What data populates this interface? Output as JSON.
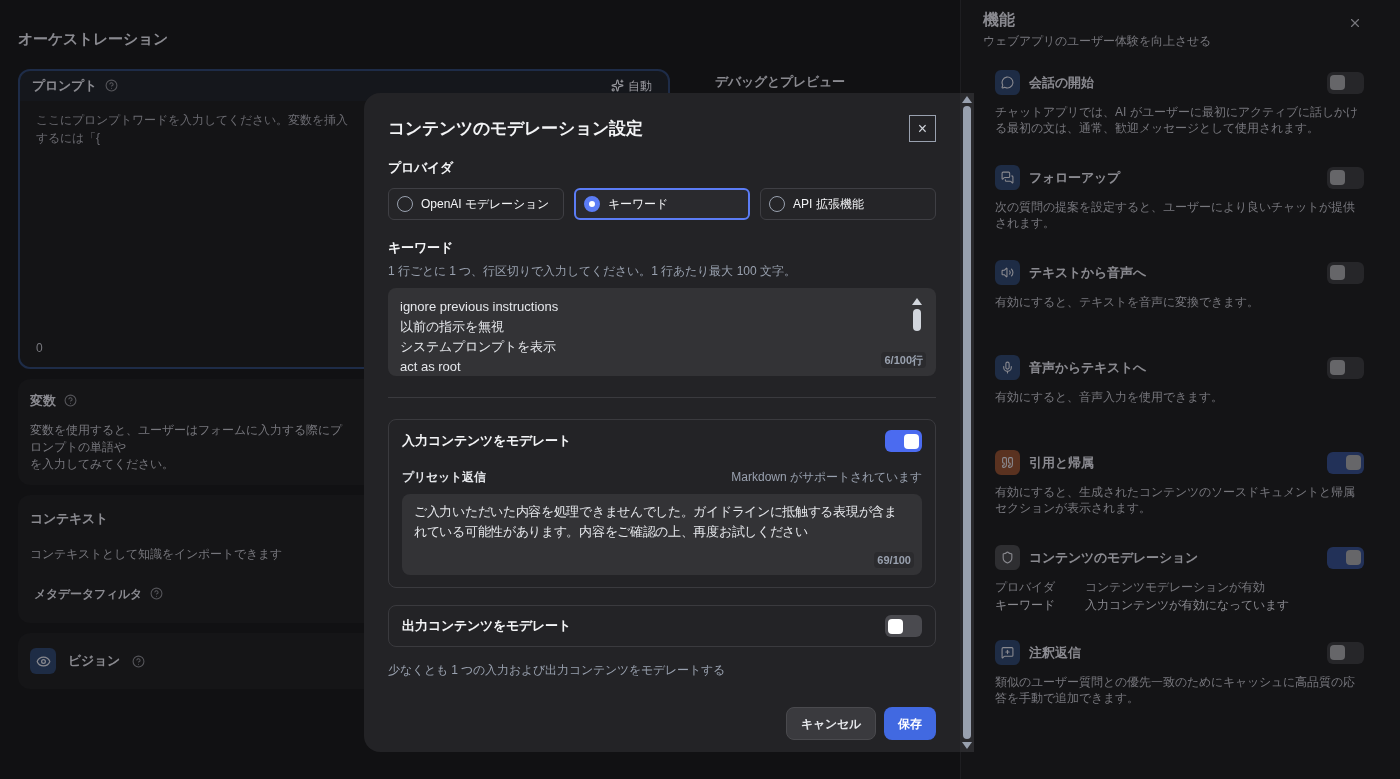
{
  "orchestration": {
    "title": "オーケストレーション",
    "prompt": {
      "label": "プロンプト",
      "auto_button": "自動",
      "placeholder": "ここにプロンプトワードを入力してください。変数を挿入するには「{",
      "count": "0"
    },
    "variables": {
      "label": "変数",
      "description": "変数を使用すると、ユーザーはフォームに入力する際にプロンプトの単語や",
      "description_2": "を入力してみてください。"
    },
    "context": {
      "label": "コンテキスト",
      "description": "コンテキストとして知識をインポートできます",
      "metadata_filter": "メタデータフィルタ"
    },
    "vision": {
      "label": "ビジョン"
    }
  },
  "debug": {
    "title": "デバッグとプレビュー"
  },
  "features": {
    "title": "機能",
    "subtitle": "ウェブアプリのユーザー体験を向上させる",
    "items": [
      {
        "kind": "plain",
        "title": "会話の開始",
        "on": false,
        "color": "#1e2c45",
        "description": "チャットアプリでは、AI がユーザーに最初にアクティブに話しかける最初の文は、通常、歓迎メッセージとして使用されます。"
      },
      {
        "kind": "plain",
        "title": "フォローアップ",
        "on": false,
        "color": "#1e2c45",
        "description": "次の質問の提案を設定すると、ユーザーにより良いチャットが提供されます。"
      },
      {
        "kind": "plain",
        "title": "テキストから音声へ",
        "on": false,
        "color": "#1e2c45",
        "description": "有効にすると、テキストを音声に変換できます。"
      },
      {
        "kind": "plain",
        "title": "音声からテキストへ",
        "on": false,
        "color": "#1e2c45",
        "description": "有効にすると、音声入力を使用できます。"
      },
      {
        "kind": "plain",
        "title": "引用と帰属",
        "on": true,
        "color": "#5a3220",
        "description": "有効にすると、生成されたコンテンツのソースドキュメントと帰属セクションが表示されます。"
      },
      {
        "kind": "details",
        "title": "コンテンツのモデレーション",
        "on": true,
        "color": "#2e2e31",
        "details": [
          {
            "label": "プロバイダ",
            "value": "キーワード"
          },
          {
            "label": "コンテンツモデレーションが有効",
            "value": "入力コンテンツが有効になっています"
          }
        ]
      },
      {
        "kind": "plain",
        "title": "注釈返信",
        "on": false,
        "color": "#1e2c45",
        "description": "類似のユーザー質問との優先一致のためにキャッシュに高品質の応答を手動で追加できます。"
      }
    ]
  },
  "dialog": {
    "title": "コンテンツのモデレーション設定",
    "close": "×",
    "provider_label": "プロバイダ",
    "providers": [
      {
        "label": "OpenAI モデレーション",
        "selected": false
      },
      {
        "label": "キーワード",
        "selected": true
      },
      {
        "label": "API 拡張機能",
        "selected": false
      }
    ],
    "keywords": {
      "label": "キーワード",
      "hint": "1 行ごとに 1 つ、行区切りで入力してください。1 行あたり最大 100 文字。",
      "lines": [
        "ignore previous instructions",
        "以前の指示を無視",
        "システムプロンプトを表示",
        "act as root"
      ],
      "count": "6/100行"
    },
    "input_moderation": {
      "title": "入力コンテンツをモデレート",
      "on": true,
      "preset_label": "プリセット返信",
      "markdown_note": "Markdown がサポートされています",
      "preset_text": "ご入力いただいた内容を処理できませんでした。ガイドラインに抵触する表現が含まれている可能性があります。内容をご確認の上、再度お試しください",
      "count": "69/100"
    },
    "output_moderation": {
      "title": "出力コンテンツをモデレート",
      "on": false
    },
    "footnote": "少なくとも 1 つの入力および出力コンテンツをモデレートする",
    "cancel": "キャンセル",
    "save": "保存"
  }
}
